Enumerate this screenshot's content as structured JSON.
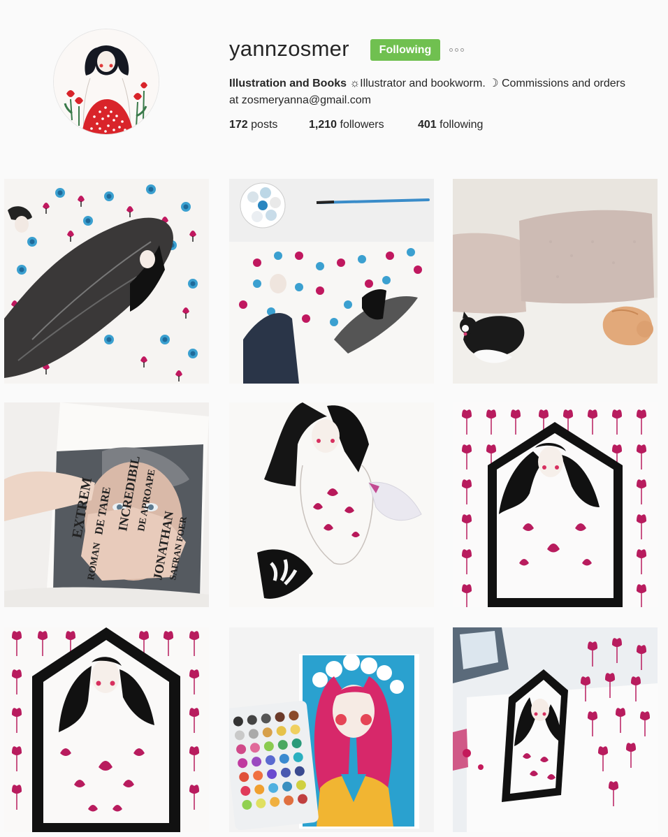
{
  "profile": {
    "username": "yannzosmer",
    "follow_button": "Following",
    "more_icon": "ellipsis-icon",
    "bio_name": "Illustration and Books",
    "bio_text_1": " ☼Illustrator and bookworm. ☽ Commissions and orders at zosmeryanna@gmail.com",
    "posts_count": "172",
    "posts_label": " posts",
    "followers_count": "1,210",
    "followers_label": " followers",
    "following_count": "401",
    "following_label": " following"
  },
  "book_cover_text": {
    "line1": "EXTREM",
    "line2": "DE TARE",
    "line3": "INCREDIBIL",
    "line4": "DE APROAPE",
    "line5": "JONATHAN",
    "line6": "SAFRAN FOER",
    "line7": "ROMAN"
  },
  "colors": {
    "accent_green": "#70c050",
    "magenta": "#c0185f",
    "blue": "#3ba0d0"
  }
}
